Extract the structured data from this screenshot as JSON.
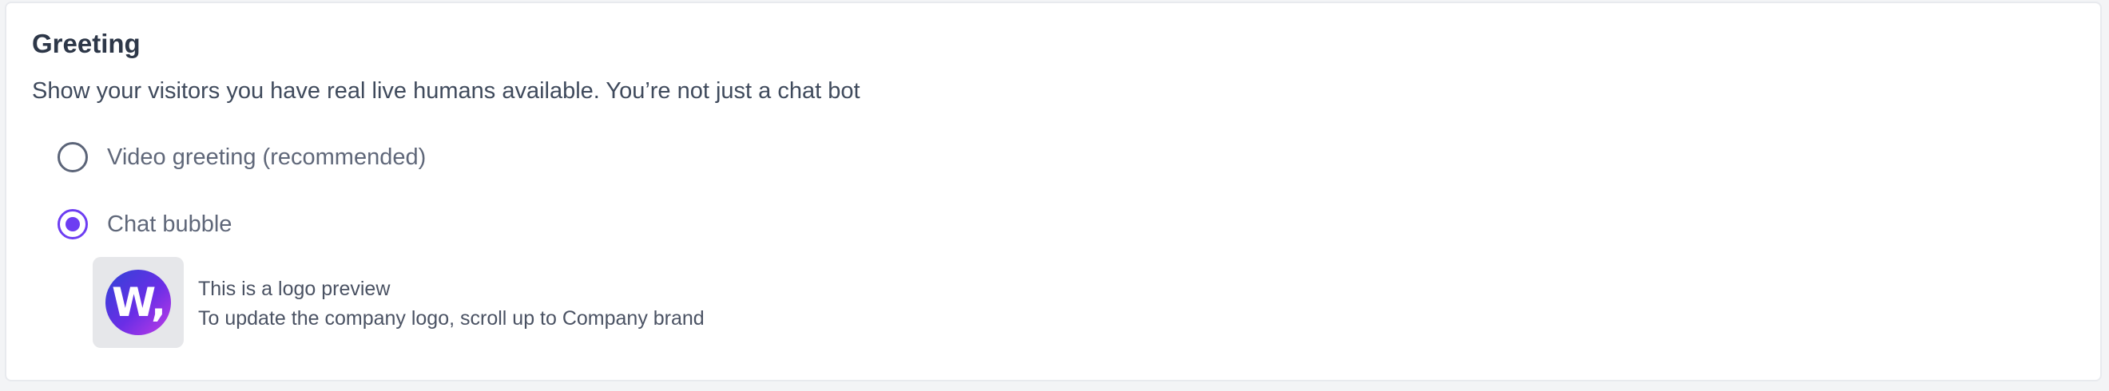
{
  "greeting": {
    "title": "Greeting",
    "description": "Show your visitors you have real live humans available. You’re not just a chat bot",
    "options": [
      {
        "label": "Video greeting (recommended)",
        "selected": false
      },
      {
        "label": "Chat bubble",
        "selected": true
      }
    ],
    "logo_preview": {
      "logo_text": "W,",
      "line1": "This is a logo preview",
      "line2": "To update the company logo, scroll up to Company brand"
    }
  },
  "colors": {
    "accent": "#6d3df2",
    "radio_unselected": "#5b6478",
    "title": "#2d3748",
    "text": "#3f4a5c"
  }
}
